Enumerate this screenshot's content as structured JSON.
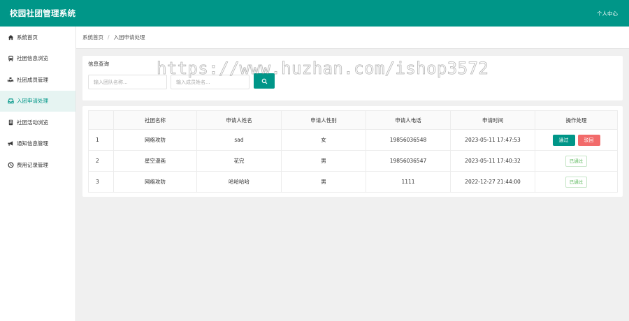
{
  "header": {
    "title": "校园社团管理系统",
    "user_center": "个人中心"
  },
  "sidebar": {
    "items": [
      {
        "label": "系统首页",
        "icon": "home-icon",
        "active": false
      },
      {
        "label": "社团信息浏览",
        "icon": "bus-icon",
        "active": false
      },
      {
        "label": "社团成员管理",
        "icon": "cubes-icon",
        "active": false
      },
      {
        "label": "入团申请处理",
        "icon": "inbox-icon",
        "active": true
      },
      {
        "label": "社团活动浏览",
        "icon": "calculator-icon",
        "active": false
      },
      {
        "label": "通知信息管理",
        "icon": "bullhorn-icon",
        "active": false
      },
      {
        "label": "费用记录管理",
        "icon": "clock-icon",
        "active": false
      }
    ]
  },
  "breadcrumb": {
    "home": "系统首页",
    "separator": "/",
    "current": "入团申请处理"
  },
  "search": {
    "title": "信息查询",
    "club_placeholder": "输入团队名称...",
    "member_placeholder": "输入成员姓名...",
    "button_icon": "search-icon"
  },
  "table": {
    "headers": [
      "",
      "社团名称",
      "申请人姓名",
      "申请人性别",
      "申请人电话",
      "申请时间",
      "操作处理"
    ],
    "pass_label": "通过",
    "reject_label": "驳回",
    "passed_label": "已通过",
    "rows": [
      {
        "index": "1",
        "club": "网络攻防",
        "name": "sad",
        "gender": "女",
        "phone": "19856036548",
        "time": "2023-05-11 17:47:53",
        "status": "pending"
      },
      {
        "index": "2",
        "club": "星空漫画",
        "name": "花完",
        "gender": "男",
        "phone": "19856036547",
        "time": "2023-05-11 17:40:32",
        "status": "passed"
      },
      {
        "index": "3",
        "club": "网络攻防",
        "name": "哈哈哈哈",
        "gender": "男",
        "phone": "1111",
        "time": "2022-12-27 21:44:00",
        "status": "passed"
      }
    ]
  },
  "watermark": "https://www.huzhan.com/ishop3572",
  "colors": {
    "primary": "#009688",
    "danger": "#f26b6b",
    "success": "#5cb85c"
  }
}
